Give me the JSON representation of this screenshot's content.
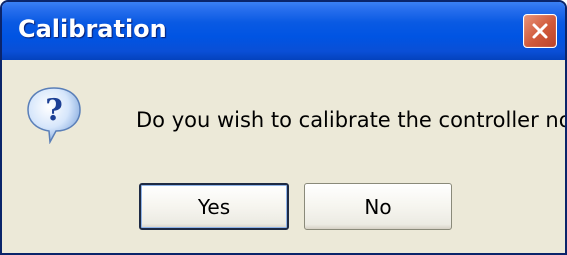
{
  "window": {
    "title": "Calibration"
  },
  "dialog": {
    "message": "Do you wish to calibrate the controller now?",
    "icon": "question-icon"
  },
  "buttons": {
    "yes_label": "Yes",
    "no_label": "No"
  },
  "colors": {
    "titlebar_blue": "#0054e3",
    "dialog_background": "#ece9d8",
    "close_button_red": "#d0593a"
  }
}
